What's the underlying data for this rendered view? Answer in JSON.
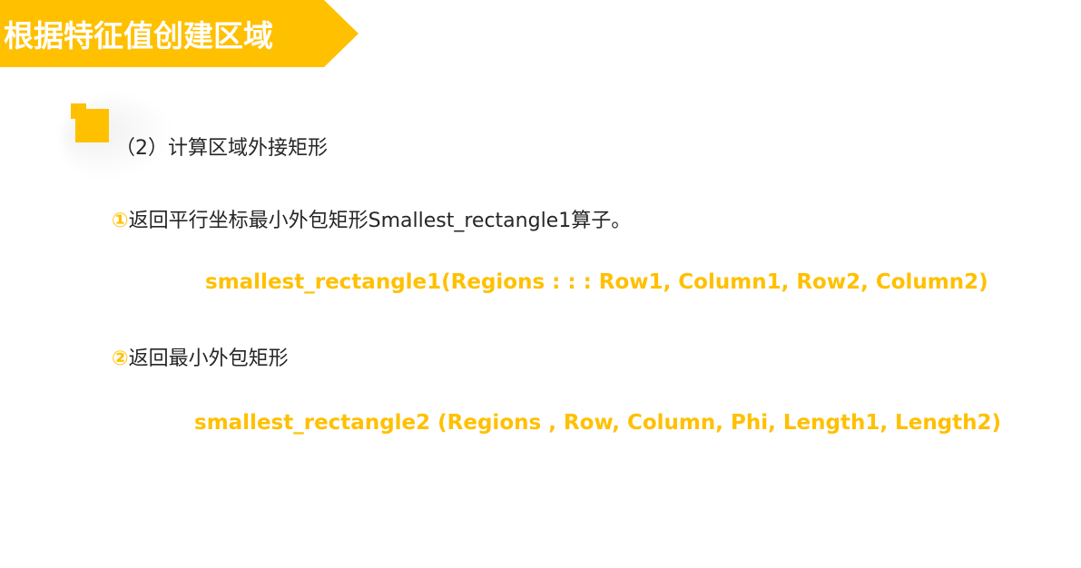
{
  "header": {
    "title": "根据特征值创建区域"
  },
  "content": {
    "subheading": "（2）计算区域外接矩形",
    "item1": {
      "marker": "①",
      "text": "返回平行坐标最小外包矩形Smallest_rectangle1算子。"
    },
    "code1": "smallest_rectangle1(Regions : : : Row1, Column1, Row2, Column2)",
    "item2": {
      "marker": "②",
      "text": "返回最小外包矩形"
    },
    "code2": "smallest_rectangle2 (Regions , Row, Column, Phi, Length1, Length2)"
  },
  "colors": {
    "accent": "#FFC000",
    "text": "#262626",
    "background": "#FFFFFF"
  }
}
